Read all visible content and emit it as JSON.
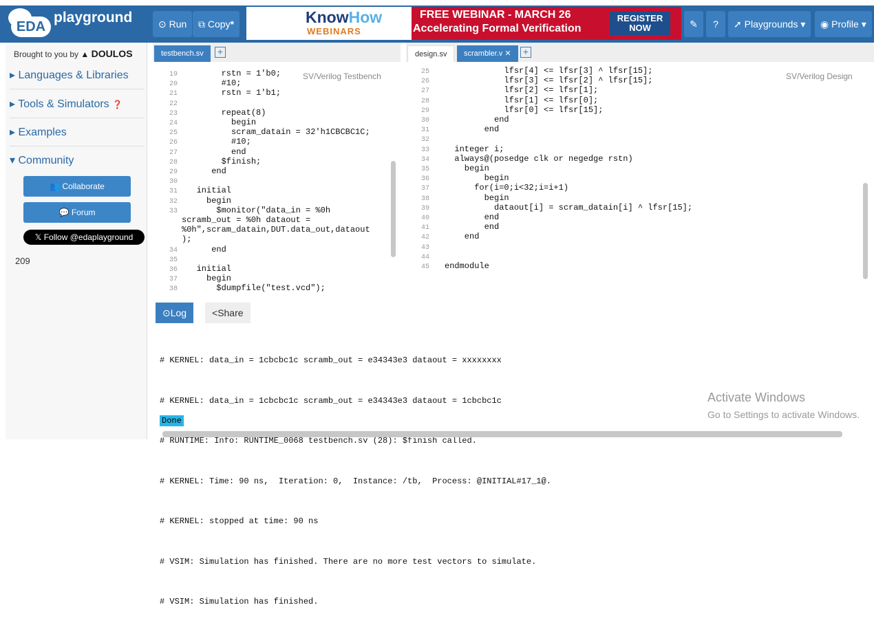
{
  "brand": {
    "eda": "EDA",
    "name": "playground"
  },
  "toolbar": {
    "run": "Run",
    "copy": "Copy",
    "playgrounds": "Playgrounds",
    "profile": "Profile"
  },
  "banner": {
    "knowhow_know": "Know",
    "knowhow_how": "How",
    "webinars": "WEBINARS",
    "line1": "FREE WEBINAR - MARCH 26",
    "line2": "Accelerating Formal Verification",
    "register": "REGISTER",
    "now": "NOW"
  },
  "sidebar": {
    "brought_by": "Brought to you by",
    "doulos": "DOULOS",
    "items": [
      "Languages & Libraries",
      "Tools & Simulators",
      "Examples",
      "Community"
    ],
    "collaborate": "Collaborate",
    "forum": "Forum",
    "follow": "Follow @edaplayground",
    "count": "209"
  },
  "left_editor": {
    "tab": "testbench.sv",
    "label": "SV/Verilog Testbench",
    "gutter": "19\n20\n21\n22\n23\n24\n25\n26\n27\n28\n29\n30\n31\n32\n33\n\n\n\n34\n35\n36\n37\n38",
    "code": "        rstn = 1'b0;\n        #10;\n        rstn = 1'b1;\n\n        repeat(8)\n          begin\n          scram_datain = 32'h1CBCBC1C;\n          #10;\n          end\n        $finish;\n      end\n\n   initial\n     begin\n       $monitor(\"data_in = %0h\nscramb_out = %0h dataout =\n%0h\",scram_datain,DUT.data_out,dataout\n);\n      end\n\n   initial\n     begin\n       $dumpfile(\"test.vcd\");"
  },
  "right_editor": {
    "tabs": [
      "design.sv",
      "scrambler.v"
    ],
    "label": "SV/Verilog Design",
    "gutter": "25\n26\n27\n28\n29\n30\n31\n32\n33\n34\n35\n36\n37\n38\n39\n40\n41\n42\n43\n44\n45",
    "code": "            lfsr[4] <= lfsr[3] ^ lfsr[15];\n            lfsr[3] <= lfsr[2] ^ lfsr[15];\n            lfsr[2] <= lfsr[1];\n            lfsr[1] <= lfsr[0];\n            lfsr[0] <= lfsr[15];\n          end\n        end\n\n  integer i;\n  always@(posedge clk or negedge rstn)\n    begin\n        begin\n      for(i=0;i<32;i=i+1)\n        begin\n          dataout[i] = scram_datain[i] ^ lfsr[15];\n        end\n        end\n    end\n\n\nendmodule"
  },
  "log": {
    "tabs": [
      "Log",
      "Share"
    ],
    "lines": [
      "# KERNEL: data_in = 1cbcbc1c scramb_out = e34343e3 dataout = xxxxxxxx",
      "# KERNEL: data_in = 1cbcbc1c scramb_out = e34343e3 dataout = 1cbcbc1c",
      "# RUNTIME: Info: RUNTIME_0068 testbench.sv (28): $finish called.",
      "# KERNEL: Time: 90 ns,  Iteration: 0,  Instance: /tb,  Process: @INITIAL#17_1@.",
      "# KERNEL: stopped at time: 90 ns",
      "# VSIM: Simulation has finished. There are no more test vectors to simulate.",
      "# VSIM: Simulation has finished."
    ],
    "status": "Done",
    "activate_title": "Activate Windows",
    "activate_sub": "Go to Settings to activate Windows."
  }
}
